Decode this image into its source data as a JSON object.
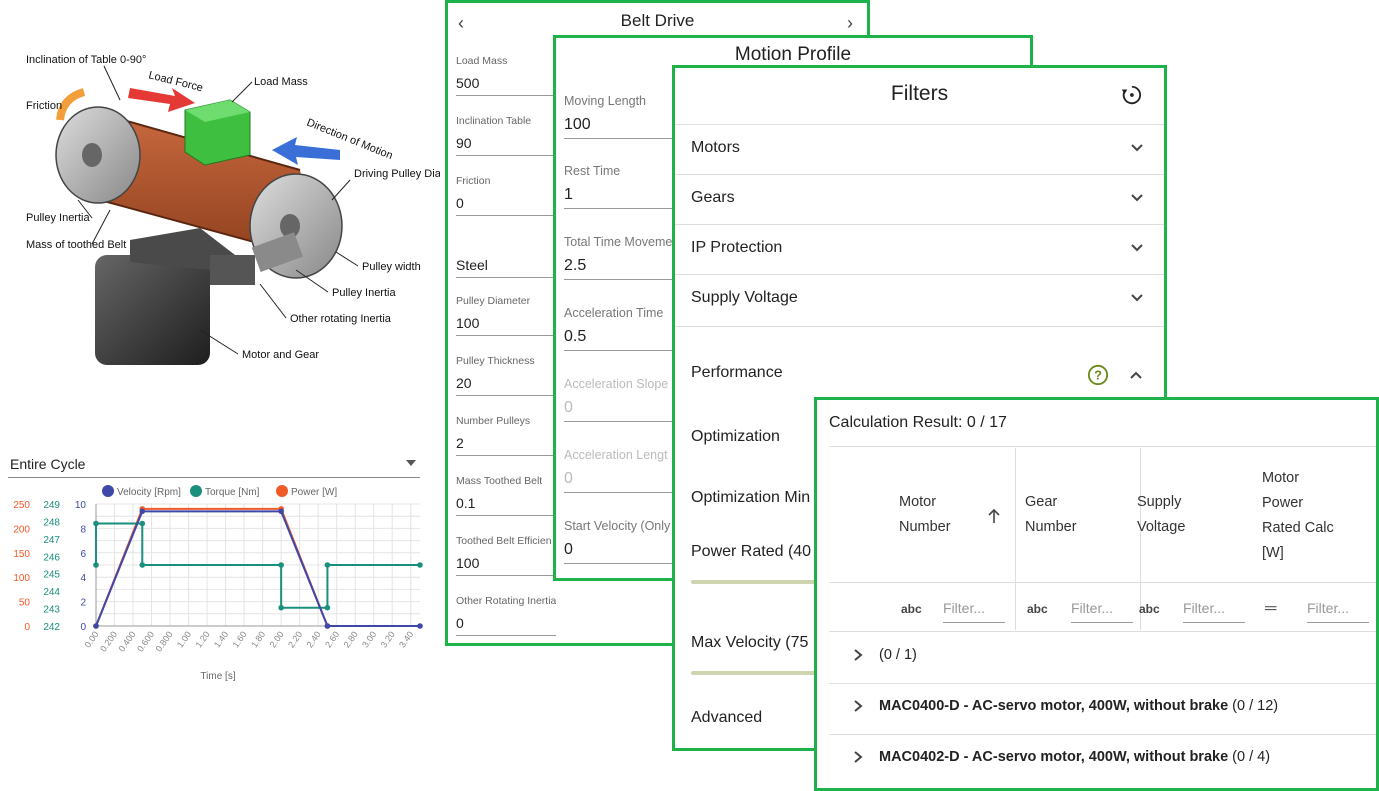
{
  "diagram": {
    "labels": {
      "inclination": "Inclination of Table 0-90°",
      "load_force": "Load Force",
      "load_mass": "Load Mass",
      "friction": "Friction",
      "direction": "Direction of Motion",
      "driving_pulley": "Driving Pulley Diameter",
      "pulley_inertia_left": "Pulley Inertia",
      "mass_belt": "Mass of toothed Belt",
      "pulley_width": "Pulley width",
      "pulley_inertia_right": "Pulley Inertia",
      "other_rotating": "Other rotating Inertia",
      "motor_gear": "Motor and Gear"
    }
  },
  "chart_area": {
    "select_value": "Entire Cycle"
  },
  "chart_data": {
    "type": "line",
    "xlabel": "Time [s]",
    "x_ticks": [
      "0.00",
      "0.200",
      "0.400",
      "0.600",
      "0.800",
      "1.00",
      "1.20",
      "1.40",
      "1.60",
      "1.80",
      "2.00",
      "2.20",
      "2.40",
      "2.60",
      "2.80",
      "3.00",
      "3.20",
      "3.40"
    ],
    "xlim": [
      0,
      3.5
    ],
    "axes": {
      "power": {
        "ticks": [
          "0",
          "50",
          "100",
          "150",
          "200",
          "250"
        ],
        "ylim": [
          0,
          250
        ],
        "color": "#f05a28"
      },
      "torque_left": {
        "ticks": [
          "242",
          "243",
          "244",
          "245",
          "246",
          "247",
          "248",
          "249"
        ],
        "ylim": [
          242,
          249
        ],
        "color": "#1a8f7e"
      },
      "velocity": {
        "ticks": [
          "0",
          "2",
          "4",
          "6",
          "8",
          "10"
        ],
        "ylim": [
          0,
          10
        ],
        "color": "#3f47a8"
      }
    },
    "series": [
      {
        "name": "Velocity [Rpm]",
        "color": "#3f47a8",
        "axis": "velocity",
        "points": [
          [
            0,
            0
          ],
          [
            0.5,
            9.4
          ],
          [
            2.0,
            9.4
          ],
          [
            2.5,
            0
          ],
          [
            3.5,
            0
          ]
        ]
      },
      {
        "name": "Torque [Nm]",
        "color": "#1a8f7e",
        "axis": "velocity",
        "points": [
          [
            0,
            5
          ],
          [
            0,
            8.4
          ],
          [
            0.5,
            8.4
          ],
          [
            0.5,
            5
          ],
          [
            2.0,
            5
          ],
          [
            2.0,
            1.5
          ],
          [
            2.5,
            1.5
          ],
          [
            2.5,
            5
          ],
          [
            3.5,
            5
          ]
        ]
      },
      {
        "name": "Power [W]",
        "color": "#f05a28",
        "axis": "velocity",
        "points": [
          [
            0,
            0
          ],
          [
            0.5,
            9.6
          ],
          [
            2.0,
            9.6
          ],
          [
            2.5,
            0
          ]
        ]
      }
    ]
  },
  "belt_drive": {
    "title": "Belt Drive",
    "prev": "‹",
    "next": "›",
    "fields": [
      {
        "label": "Load Mass",
        "value": "500"
      },
      {
        "label": "Inclination Table",
        "value": "90"
      },
      {
        "label": "Friction",
        "value": "0"
      },
      {
        "label": "",
        "value": "Steel"
      },
      {
        "label": "Pulley Diameter",
        "value": "100"
      },
      {
        "label": "Pulley Thickness",
        "value": "20"
      },
      {
        "label": "Number Pulleys",
        "value": "2"
      },
      {
        "label": "Mass Toothed Belt",
        "value": "0.1"
      },
      {
        "label": "Toothed Belt Efficien",
        "value": "100"
      },
      {
        "label": "Other Rotating Inertia",
        "value": "0"
      }
    ]
  },
  "motion_profile": {
    "title": "Motion Profile",
    "fields": [
      {
        "label": "Moving Length",
        "value": "100"
      },
      {
        "label": "Rest Time",
        "value": "1"
      },
      {
        "label": "Total Time Moveme",
        "value": "2.5"
      },
      {
        "label": "Acceleration Time",
        "value": "0.5"
      },
      {
        "label": "Acceleration Slope",
        "value": "0"
      },
      {
        "label": "Acceleration Lengt",
        "value": "0"
      },
      {
        "label": "Start Velocity (Only",
        "value": "0"
      }
    ]
  },
  "filters": {
    "title": "Filters",
    "sections": [
      "Motors",
      "Gears",
      "IP Protection",
      "Supply Voltage"
    ],
    "performance": "Performance",
    "optimization": "Optimization",
    "optimization_min": "Optimization Min",
    "power_rated": "Power Rated (40",
    "max_velocity": "Max Velocity (75",
    "advanced": "Advanced"
  },
  "results": {
    "title": "Calculation Result: 0 / 17",
    "columns": [
      {
        "line1": "Motor",
        "line2": "Number"
      },
      {
        "line1": "Gear",
        "line2": "Number"
      },
      {
        "line1": "Supply",
        "line2": "Voltage"
      },
      {
        "line1": "Motor",
        "line2": "Power",
        "line3": "Rated Calc",
        "line4": "[W]"
      }
    ],
    "abc": "abc",
    "filter_placeholder": "Filter...",
    "groups": [
      {
        "name": "",
        "count": "(0 / 1)"
      },
      {
        "name": "MAC0400-D - AC-servo motor, 400W, without brake",
        "count": " (0 / 12)"
      },
      {
        "name": "MAC0402-D - AC-servo motor, 400W, without brake",
        "count": " (0 / 4)"
      }
    ]
  }
}
